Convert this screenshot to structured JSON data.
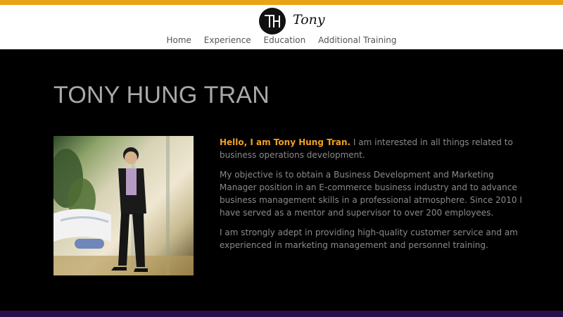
{
  "header": {
    "logo_text": "Tony",
    "logo_monogram": "TH"
  },
  "nav": {
    "items": [
      "Home",
      "Experience",
      "Education",
      "Additional Training"
    ]
  },
  "main": {
    "title": "TONY HUNG TRAN",
    "intro_highlight": "Hello, I am Tony Hung Tran.",
    "intro_rest": " I am interested in all things related to business operations development.",
    "paragraph_2": "My objective is to obtain a Business Development and Marketing Manager position in an E-commerce business industry and to advance business management skills in a professional atmosphere. Since 2010 I have served as a mentor and supervisor to over 200 employees.",
    "paragraph_3": "I am strongly adept in providing high-quality customer service and am experienced in marketing management and personnel training."
  },
  "colors": {
    "accent": "#e8a317",
    "highlight": "#f0a020",
    "footer": "#2a0f4a"
  }
}
